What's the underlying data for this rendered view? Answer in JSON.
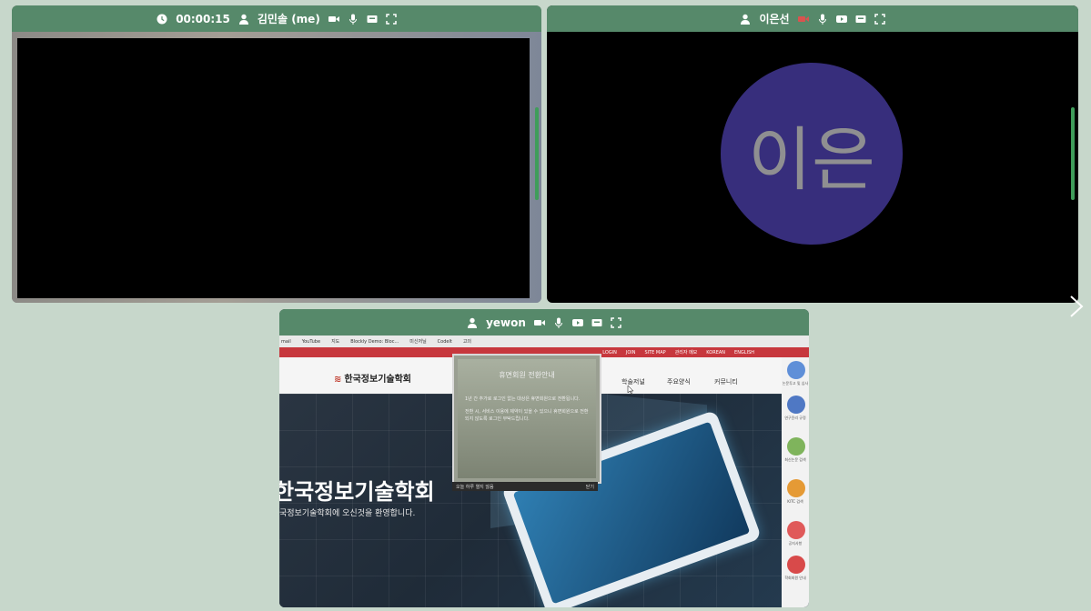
{
  "tiles": [
    {
      "timer": "00:00:15",
      "name": "김민솔 (me)",
      "icons": [
        "clock-icon",
        "person-icon",
        "camera-icon",
        "mic-icon",
        "screen-share-icon",
        "fullscreen-icon"
      ]
    },
    {
      "name": "이은선",
      "avatar_text": "이은",
      "avatar_color": "#372e7c",
      "icons": [
        "person-icon",
        "camera-off-icon",
        "mic-icon",
        "youtube-icon",
        "screen-share-icon",
        "fullscreen-icon"
      ]
    },
    {
      "name": "yewon",
      "icons": [
        "person-icon",
        "camera-icon",
        "mic-icon",
        "youtube-icon",
        "screen-share-icon",
        "fullscreen-icon"
      ]
    }
  ],
  "shared_screen": {
    "bookmarks": [
      "mail",
      "YouTube",
      "지도",
      "Blockly Demo: Bloc...",
      "미신저닐",
      "Codelt",
      "고의"
    ],
    "topbar": [
      "LOGIN",
      "JOIN",
      "SITE MAP",
      "관리자 메모",
      "KOREAN",
      "ENGLISH"
    ],
    "logo": "한국정보기술학회",
    "menu": [
      "학술저널",
      "주요양식",
      "커뮤니티"
    ],
    "hero_title": "한국정보기술학회",
    "hero_subtitle": "국정보기술학회에 오신것을 환영합니다.",
    "popup": {
      "title": "휴면회원 전환안내",
      "body1": "1년 간 추가로 로그인 없는 대상은 휴면회원으로 전환됩니다.",
      "body2": "전환 시, 서비스 이용에 제약이 있을 수 있으니 휴면회원으로 전환되지 않도록 로그인 부탁드립니다.",
      "footer_left": "오늘 하루 열지 않음",
      "footer_right": "닫기"
    },
    "side": [
      {
        "label": "논문투고 및 심사",
        "color": "#5f8fd8"
      },
      {
        "label": "연구윤리 규정",
        "color": "#4f78c4"
      },
      {
        "label": "최신논문 검색",
        "color": "#7fb45c"
      },
      {
        "label": "KITC 검색",
        "color": "#e59a35"
      },
      {
        "label": "공지사항",
        "color": "#e05a5a"
      },
      {
        "label": "학회회원 안내",
        "color": "#d84a4a"
      }
    ]
  },
  "colors": {
    "header": "#56896a",
    "background": "#c7d7cb",
    "level_bar": "#3f9d5a"
  }
}
